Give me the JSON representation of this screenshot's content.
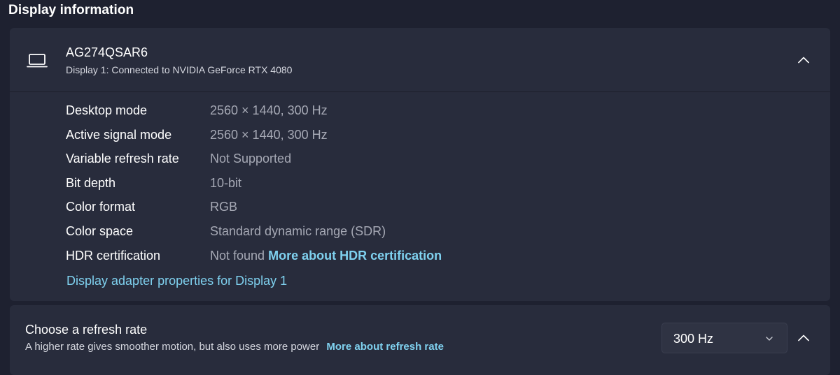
{
  "section_title": "Display information",
  "display": {
    "name": "AG274QSAR6",
    "subtitle": "Display 1: Connected to NVIDIA GeForce RTX 4080",
    "rows": [
      {
        "label": "Desktop mode",
        "value": "2560 × 1440, 300 Hz"
      },
      {
        "label": "Active signal mode",
        "value": "2560 × 1440, 300 Hz"
      },
      {
        "label": "Variable refresh rate",
        "value": "Not Supported"
      },
      {
        "label": "Bit depth",
        "value": "10-bit"
      },
      {
        "label": "Color format",
        "value": "RGB"
      },
      {
        "label": "Color space",
        "value": "Standard dynamic range (SDR)"
      },
      {
        "label": "HDR certification",
        "value": "Not found",
        "link": "More about HDR certification"
      }
    ],
    "adapter_link": "Display adapter properties for Display 1"
  },
  "refresh": {
    "title": "Choose a refresh rate",
    "subtitle": "A higher rate gives smoother motion, but also uses more power",
    "link": "More about refresh rate",
    "selected": "300 Hz"
  },
  "icons": {
    "monitor": "laptop-icon",
    "collapse": "chevron-up-icon",
    "dropdown": "chevron-down-icon"
  },
  "colors": {
    "background": "#1e2130",
    "card": "#282c3c",
    "link": "#7fd1ef",
    "muted": "#a6a9b5"
  }
}
